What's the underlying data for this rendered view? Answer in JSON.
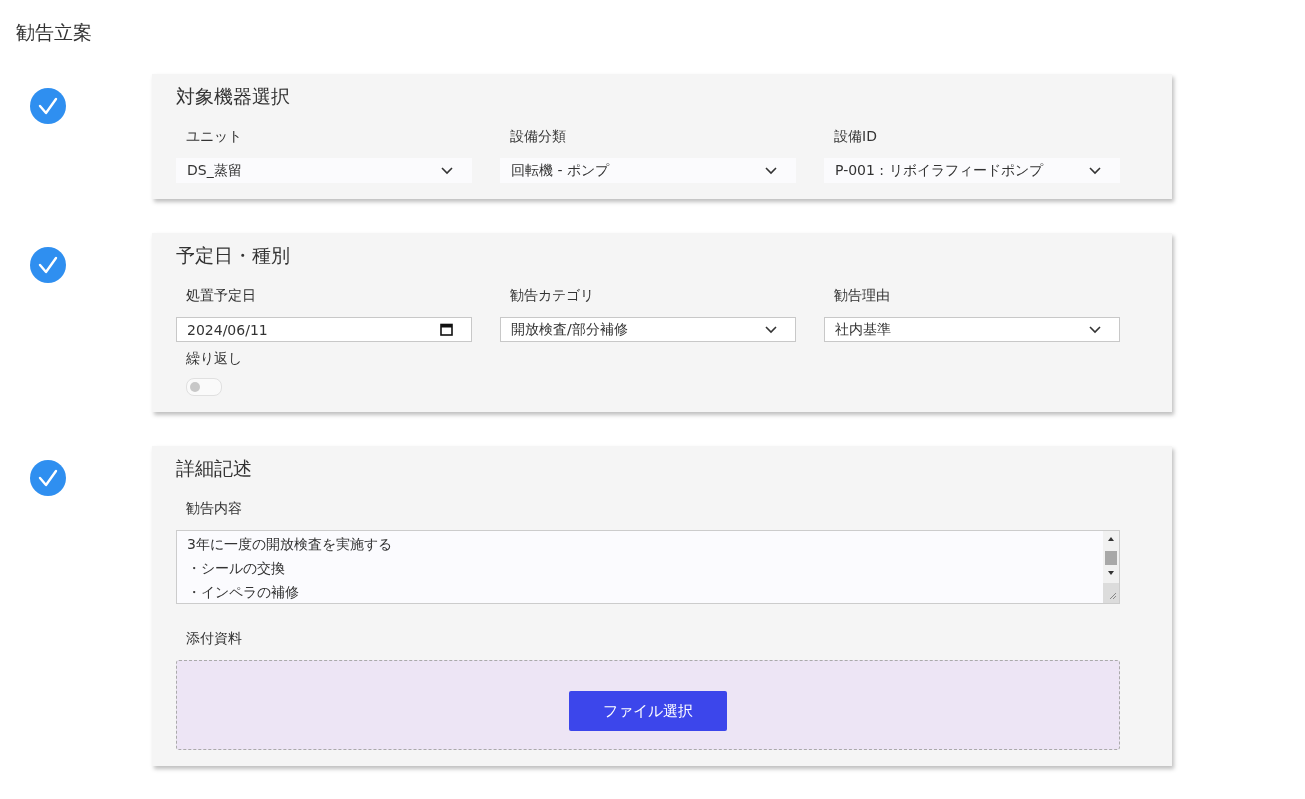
{
  "page": {
    "title": "勧告立案"
  },
  "sections": [
    {
      "title": "対象機器選択",
      "completed": true,
      "fields": [
        {
          "kind": "select",
          "label": "ユニット",
          "value": "DS_蒸留",
          "bordered": false
        },
        {
          "kind": "select",
          "label": "設備分類",
          "value": "回転機 - ポンプ",
          "bordered": false
        },
        {
          "kind": "select",
          "label": "設備ID",
          "value": "P-001 : リボイラフィードポンプ",
          "bordered": false
        }
      ]
    },
    {
      "title": "予定日・種別",
      "completed": true,
      "fields": [
        {
          "kind": "date",
          "label": "処置予定日",
          "value": "2024/06/11"
        },
        {
          "kind": "select",
          "label": "勧告カテゴリ",
          "value": "開放検査/部分補修",
          "bordered": true
        },
        {
          "kind": "select",
          "label": "勧告理由",
          "value": "社内基準",
          "bordered": true
        },
        {
          "kind": "toggle",
          "label": "繰り返し",
          "on": false
        }
      ]
    },
    {
      "title": "詳細記述",
      "completed": true,
      "fields": [
        {
          "kind": "textarea",
          "label": "勧告内容",
          "lines": [
            "3年に一度の開放検査を実施する",
            "・シールの交換",
            "・インペラの補修"
          ]
        },
        {
          "kind": "file",
          "label": "添付資料",
          "button": "ファイル選択"
        }
      ]
    }
  ]
}
